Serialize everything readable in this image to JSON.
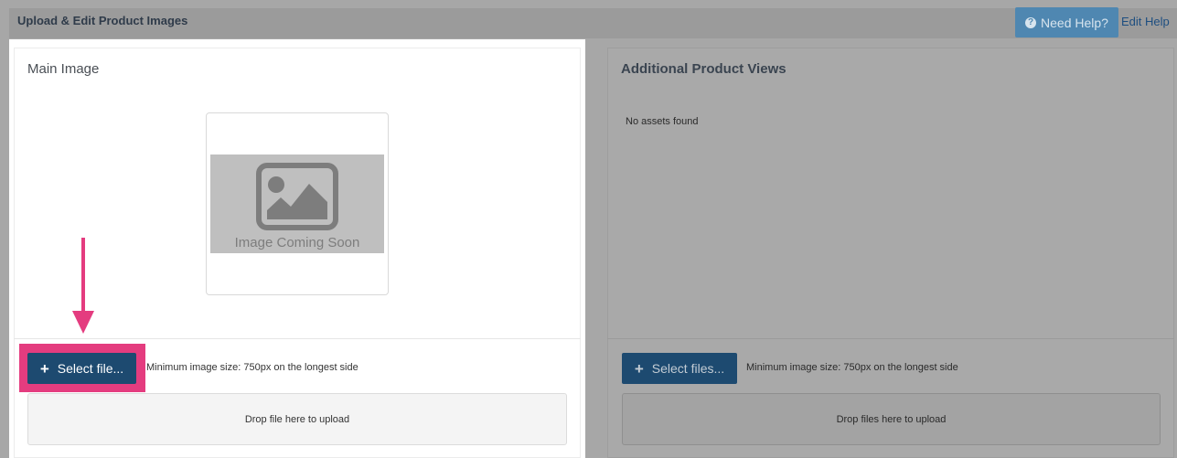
{
  "header": {
    "title": "Upload & Edit Product Images",
    "help_button_label": "Need Help?",
    "edit_help_label": "Edit Help"
  },
  "main_image": {
    "title": "Main Image",
    "placeholder_text": "Image Coming Soon",
    "select_button_label": "Select file...",
    "min_size_text": "Minimum image size: 750px on the longest side",
    "drop_zone_text": "Drop file here to upload"
  },
  "additional_views": {
    "title": "Additional Product Views",
    "empty_text": "No assets found",
    "select_button_label": "Select files...",
    "min_size_text": "Minimum image size: 750px on the longest side",
    "drop_zone_text": "Drop files here to upload"
  },
  "colors": {
    "overlay": "#a7a7a7",
    "primary_button": "#1d4a70",
    "help_button": "#4f87b1",
    "annotation": "#e43c7f"
  },
  "icons": {
    "help": "question-circle-icon",
    "add": "plus-icon",
    "placeholder": "image-icon",
    "annotation": "arrow-down-icon"
  }
}
